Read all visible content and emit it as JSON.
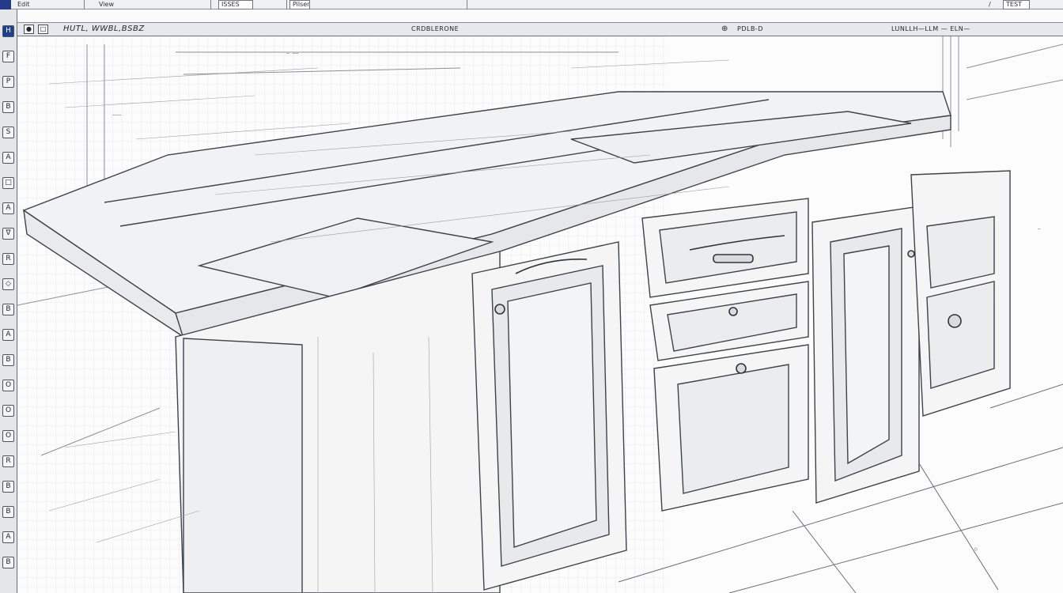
{
  "menu": {
    "file_label": "Edit",
    "view_label": "View",
    "doc_tab_label": "ISSES",
    "tool_tab_label": "Pilsen",
    "right_tab_label": "TEST"
  },
  "toolbar": {
    "left_label": "HUTL, WWBL,BSBZ",
    "center_label": "CRDBLERONE",
    "snap_label": "PDLB-D",
    "right_label": "LUNLLH—LLM — ELN—"
  },
  "palette": {
    "tools": [
      "H",
      "F",
      "P",
      "B",
      "S",
      "A",
      "□",
      "A",
      "∇",
      "R",
      "◇",
      "B",
      "A",
      "B",
      "O",
      "O",
      "O",
      "R",
      "B",
      "B",
      "A",
      "B"
    ]
  },
  "icons": {
    "app_logo": "app-logo-icon",
    "pointer": "cursor-icon",
    "snap": "snap-icon",
    "compass": "compass-icon"
  },
  "colors": {
    "accent": "#1f3f8f",
    "line": "#4a4f55",
    "grid": "#c9ccd0",
    "panel": "#e4e6e9"
  }
}
